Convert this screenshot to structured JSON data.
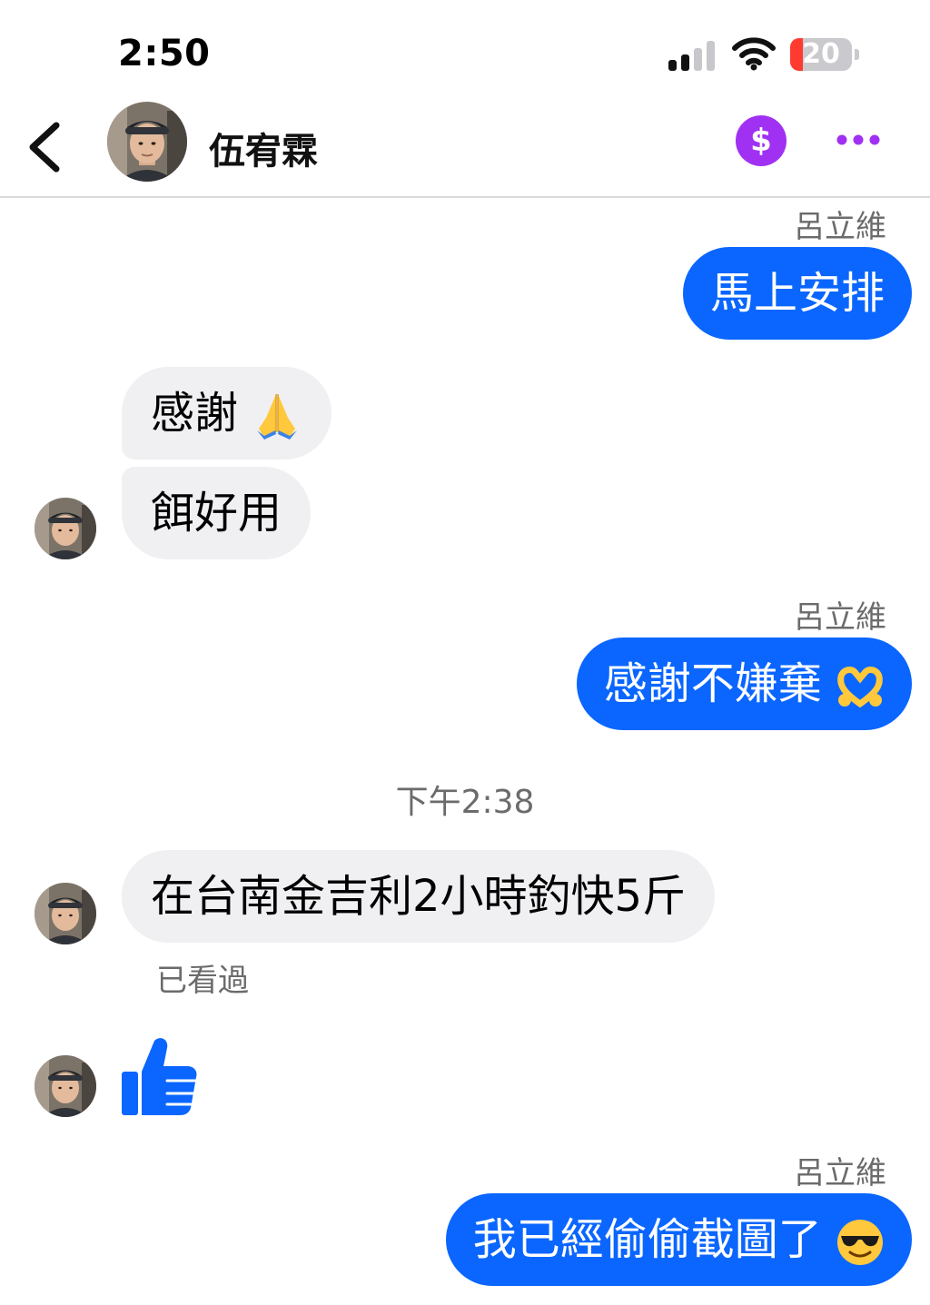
{
  "status_bar": {
    "time": "2:50",
    "battery_level": "20",
    "battery_fraction": 0.2,
    "signal_bars_active": 2,
    "signal_bars_total": 4
  },
  "header": {
    "contact_name": "伍宥霖",
    "pay_icon": "dollar-sign-icon",
    "more_icon": "more-dots-icon",
    "back_icon": "chevron-left-icon"
  },
  "colors": {
    "outgoing_bubble": "#0a66ff",
    "incoming_bubble": "#f0f0f3",
    "accent": "#a131f2",
    "secondary_text": "#6b6b6b"
  },
  "messages": [
    {
      "direction": "out",
      "sender": "呂立維",
      "text": "馬上安排"
    },
    {
      "direction": "in",
      "text": "感謝",
      "emoji": "folded-hands-emoji"
    },
    {
      "direction": "in",
      "text": "餌好用"
    },
    {
      "direction": "out",
      "sender": "呂立維",
      "text": "感謝不嫌棄",
      "emoji": "heart-hands-emoji"
    },
    {
      "direction": "timestamp",
      "text": "下午2:38"
    },
    {
      "direction": "in",
      "text": "在台南金吉利2小時釣快5斤",
      "status": "已看過"
    },
    {
      "direction": "in",
      "emoji": "thumbs-up-icon"
    },
    {
      "direction": "out",
      "sender": "呂立維",
      "text": "我已經偷偷截圖了",
      "emoji": "sunglasses-face-emoji"
    }
  ]
}
